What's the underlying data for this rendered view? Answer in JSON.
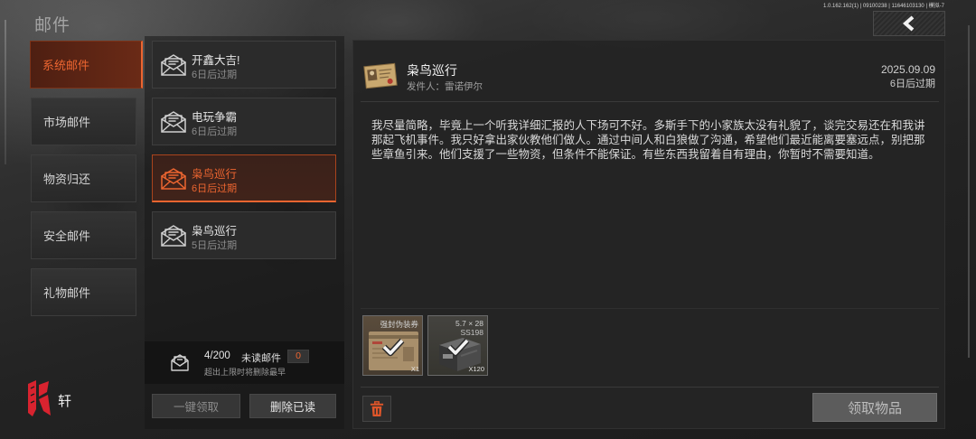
{
  "header": {
    "title": "邮件",
    "version": "1.0.162.162(1) | 09100238 | 11646103130 | 模拟-7",
    "back_icon": "chevron-left-icon"
  },
  "colors": {
    "accent": "#ec6530",
    "selected_bg": "#5a2414"
  },
  "categories": [
    {
      "label": "系统邮件",
      "selected": true
    },
    {
      "label": "市场邮件",
      "selected": false
    },
    {
      "label": "物资归还",
      "selected": false
    },
    {
      "label": "安全邮件",
      "selected": false
    },
    {
      "label": "礼物邮件",
      "selected": false
    }
  ],
  "brand": {
    "logo_icon": "red-claw-logo-icon",
    "name": "轩"
  },
  "mail_list": {
    "items": [
      {
        "icon": "envelope-icon",
        "title": "开鑫大吉!",
        "expiry": "6日后过期",
        "selected": false
      },
      {
        "icon": "envelope-icon",
        "title": "电玩争霸",
        "expiry": "6日后过期",
        "selected": false
      },
      {
        "icon": "envelope-icon",
        "title": "枭鸟巡行",
        "expiry": "6日后过期",
        "selected": true
      },
      {
        "icon": "envelope-icon",
        "title": "枭鸟巡行",
        "expiry": "5日后过期",
        "selected": false
      }
    ],
    "summary": {
      "icon": "mailbox-icon",
      "count": "4/200",
      "unread_label": "未读邮件",
      "unread_count": "0",
      "limit_note": "超出上限时将删除最早"
    },
    "actions": {
      "claim_all": {
        "label": "一键领取",
        "enabled": false
      },
      "delete_read": {
        "label": "删除已读",
        "enabled": true
      }
    }
  },
  "detail": {
    "thumbnail_icon": "letter-photo-icon",
    "title": "枭鸟巡行",
    "sender": "发件人：雷诺伊尔",
    "date": "2025.09.09",
    "expiry": "6日后过期",
    "body": "我尽量简略，毕竟上一个听我详细汇报的人下场可不好。多斯手下的小家族太没有礼貌了，谈完交易还在和我讲那起飞机事件。我只好拿出家伙教他们做人。通过中间人和白狼做了沟通，希望他们最近能离要塞远点，别把那些章鱼引来。他们支援了一些物资，但条件不能保证。有些东西我留着自有理由，你暂时不需要知道。",
    "attachments": [
      {
        "icon": "disguise-voucher-icon",
        "name": "强封伪装券",
        "quantity": "X1",
        "claimed": true
      },
      {
        "icon": "ammo-box-icon",
        "name": "5.7 × 28",
        "subname": "SS198",
        "quantity": "X120",
        "claimed": true
      }
    ],
    "delete_icon": "trash-icon",
    "claim": {
      "label": "领取物品",
      "enabled": false
    }
  }
}
